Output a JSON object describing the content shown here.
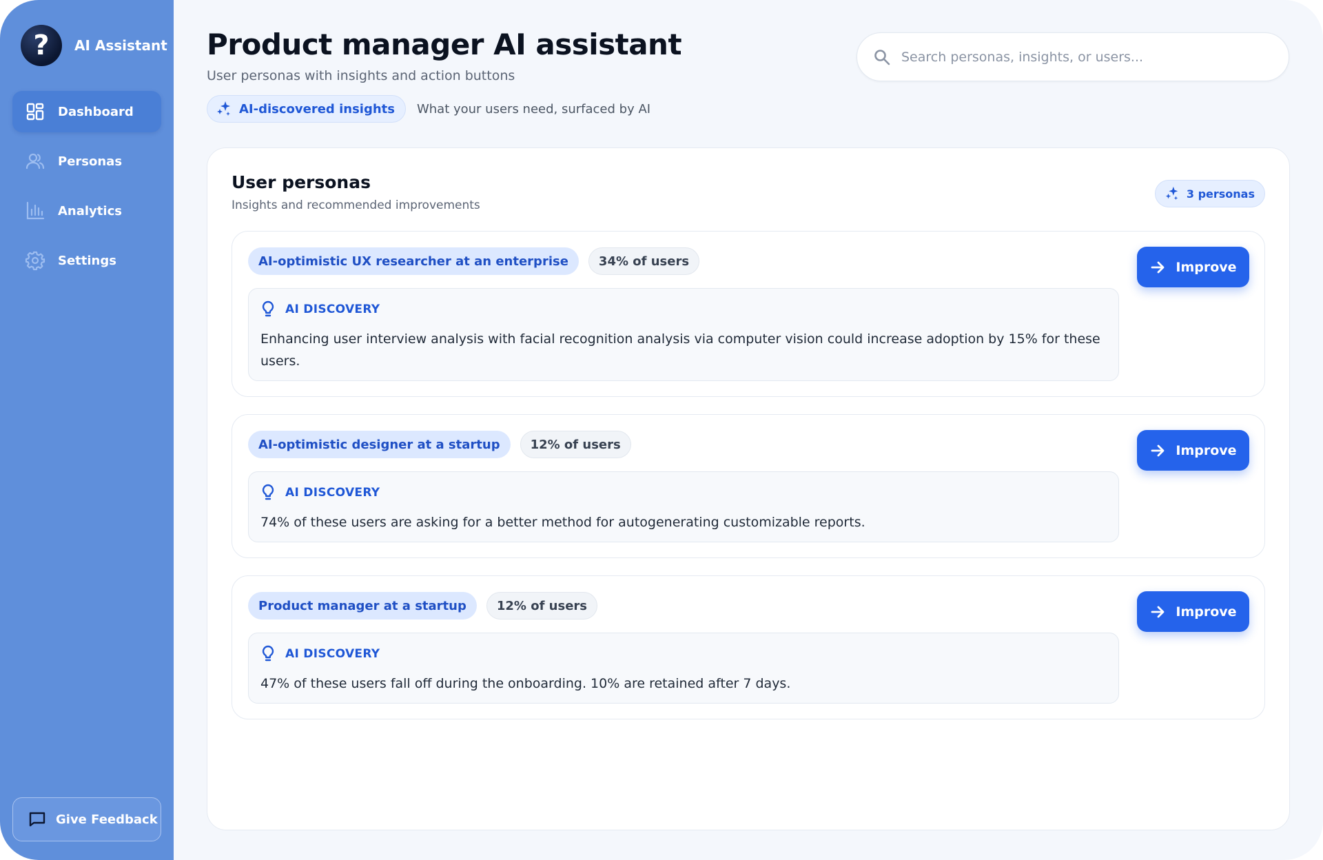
{
  "brand": {
    "name": "AI Assistant",
    "logo_glyph": "?"
  },
  "nav": {
    "items": [
      {
        "label": "Dashboard",
        "icon": "dashboard-grid-icon",
        "active": true
      },
      {
        "label": "Personas",
        "icon": "users-icon",
        "active": false
      },
      {
        "label": "Analytics",
        "icon": "bar-chart-icon",
        "active": false
      },
      {
        "label": "Settings",
        "icon": "gear-icon",
        "active": false
      }
    ]
  },
  "feedback": {
    "label": "Give Feedback",
    "icon": "message-square-icon"
  },
  "header": {
    "title": "Product manager AI assistant",
    "subtitle": "User personas with insights and action buttons",
    "insights_badge": "AI-discovered insights",
    "insights_caption": "What your users need, surfaced by AI"
  },
  "search": {
    "placeholder": "Search personas, insights, or users...",
    "value": ""
  },
  "panel": {
    "title": "User personas",
    "subtitle": "Insights and recommended improvements",
    "count_badge": "3 personas"
  },
  "personas": [
    {
      "name": "AI-optimistic UX researcher at an enterprise",
      "share": "34% of users",
      "discovery_label": "AI DISCOVERY",
      "insight": "Enhancing user interview analysis with facial recognition analysis via computer vision could increase adoption by 15% for these users.",
      "action": "Improve"
    },
    {
      "name": "AI-optimistic designer at a startup",
      "share": "12% of users",
      "discovery_label": "AI DISCOVERY",
      "insight": "74% of these users are asking for a better method for autogenerating customizable reports.",
      "action": "Improve"
    },
    {
      "name": "Product manager at a startup",
      "share": "12% of users",
      "discovery_label": "AI DISCOVERY",
      "insight": "47% of these users fall off during the onboarding. 10% are retained after 7 days.",
      "action": "Improve"
    }
  ],
  "colors": {
    "sidebar": "#5f8fdb",
    "accent": "#2563eb",
    "accent_text": "#1f57d6",
    "page_background": "#f4f7fc"
  }
}
